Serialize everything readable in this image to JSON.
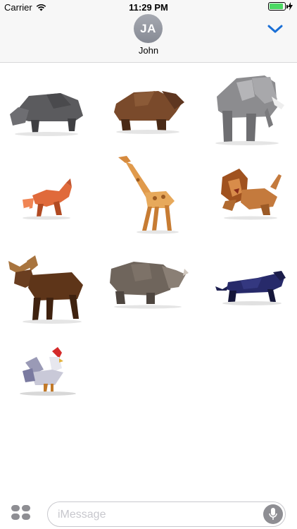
{
  "status_bar": {
    "carrier": "Carrier",
    "time": "11:29 PM",
    "wifi_icon": "wifi-icon",
    "battery_icon": "battery-charging-icon",
    "battery_level": 0.9
  },
  "header": {
    "avatar_initials": "JA",
    "contact_name": "John",
    "collapse_icon": "chevron-down-icon"
  },
  "stickers": [
    {
      "name": "hippo",
      "icon": "hippo-sticker"
    },
    {
      "name": "bear",
      "icon": "bear-sticker"
    },
    {
      "name": "elephant",
      "icon": "elephant-sticker"
    },
    {
      "name": "fox",
      "icon": "fox-sticker"
    },
    {
      "name": "giraffe",
      "icon": "giraffe-sticker"
    },
    {
      "name": "lion",
      "icon": "lion-sticker"
    },
    {
      "name": "moose",
      "icon": "moose-sticker"
    },
    {
      "name": "rhino",
      "icon": "rhino-sticker"
    },
    {
      "name": "panther",
      "icon": "panther-sticker"
    },
    {
      "name": "rooster",
      "icon": "rooster-sticker"
    }
  ],
  "composer": {
    "placeholder": "iMessage",
    "apps_icon": "app-drawer-icon",
    "mic_icon": "microphone-icon"
  },
  "colors": {
    "accent": "#1a6fd6",
    "header_bg": "#f7f7f7",
    "battery": "#4cd964"
  }
}
